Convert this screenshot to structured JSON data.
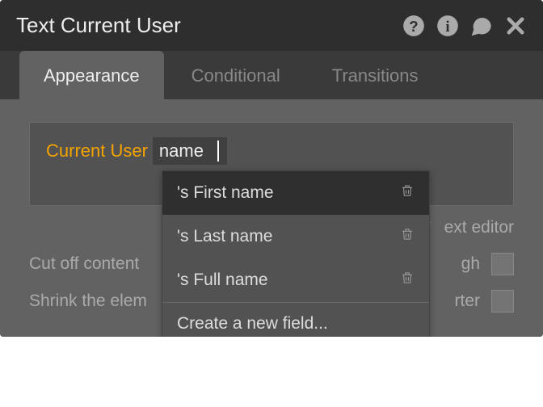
{
  "header": {
    "title": "Text Current User"
  },
  "tabs": {
    "appearance": "Appearance",
    "conditional": "Conditional",
    "transitions": "Transitions"
  },
  "expression": {
    "static": "Current User",
    "input_value": "name"
  },
  "dropdown": {
    "items": [
      {
        "label": "'s First name"
      },
      {
        "label": "'s Last name"
      },
      {
        "label": "'s Full name"
      }
    ],
    "create": "Create a new field..."
  },
  "rows": {
    "rich_editor_trailing": "ext editor",
    "cutoff_leading": "Cut off content",
    "cutoff_trailing": "gh",
    "shrink_leading": "Shrink the elem",
    "shrink_trailing": "rter"
  }
}
